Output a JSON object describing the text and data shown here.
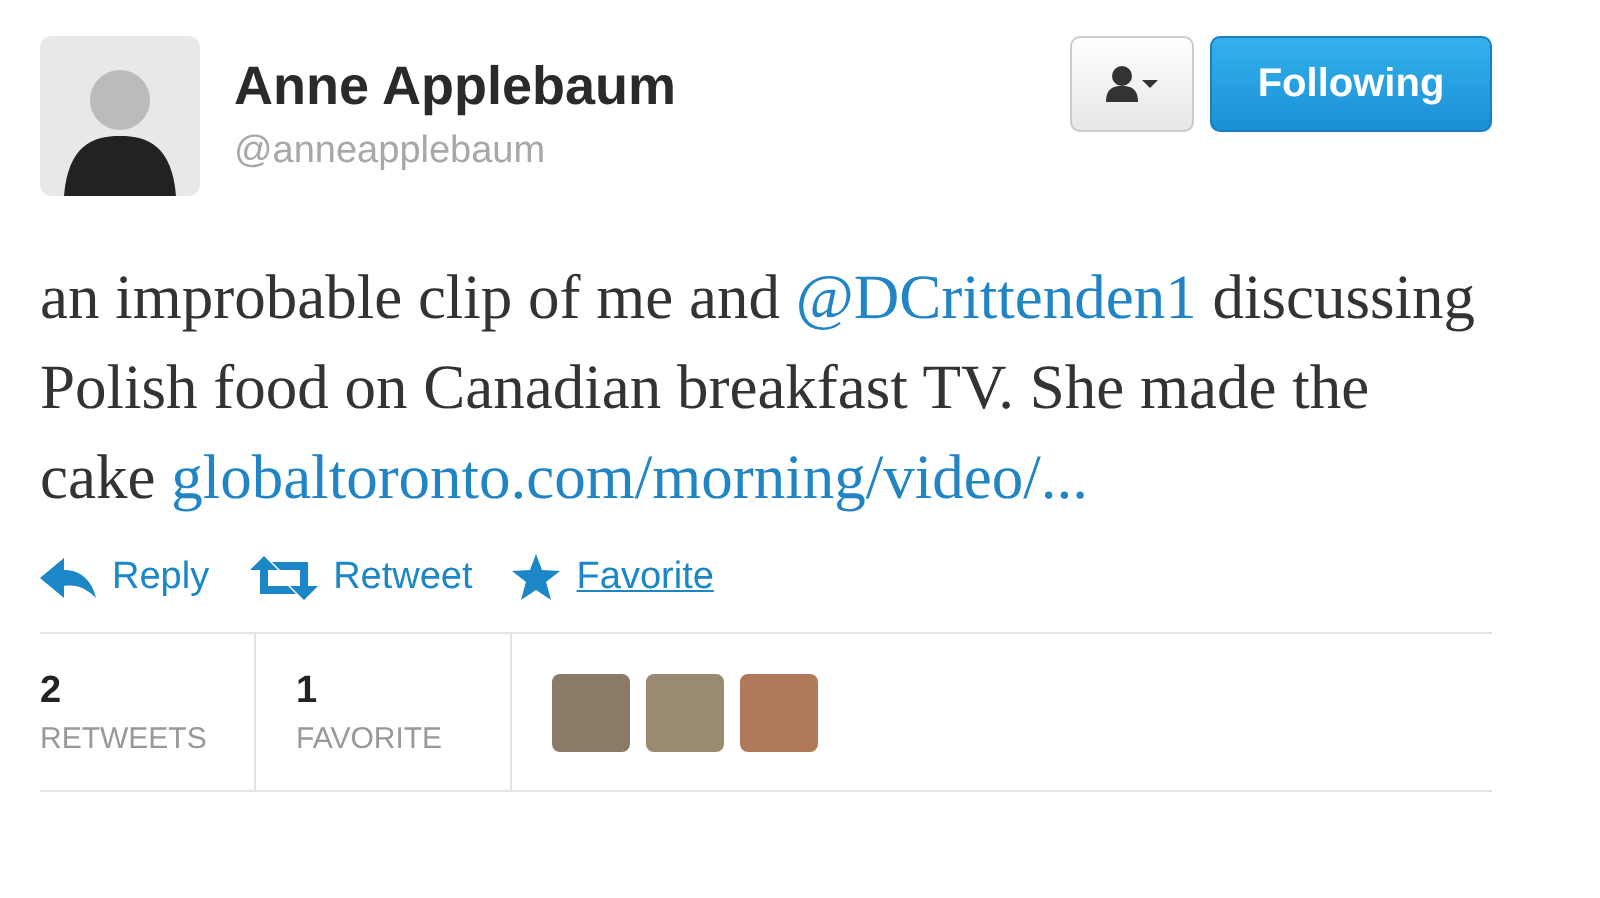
{
  "author": {
    "name": "Anne Applebaum",
    "handle": "@anneapplebaum"
  },
  "follow_button": {
    "label": "Following",
    "following": true
  },
  "tweet": [
    {
      "kind": "text",
      "text": "an improbable clip of me and "
    },
    {
      "kind": "link",
      "text": "@DCrittenden1"
    },
    {
      "kind": "text",
      "text": " discussing Polish food on Canadian breakfast TV. She made the cake "
    },
    {
      "kind": "link",
      "text": "globaltoronto.com/morning/video/..."
    }
  ],
  "actions": [
    {
      "label": "Reply",
      "kind": "reply",
      "hovered": false
    },
    {
      "label": "Retweet",
      "kind": "retweet",
      "hovered": false
    },
    {
      "label": "Favorite",
      "kind": "favorite",
      "hovered": true
    }
  ],
  "stats": [
    {
      "count": "2",
      "label": "RETWEETS"
    },
    {
      "count": "1",
      "label": "FAVORITE"
    }
  ],
  "favoriters": [
    {
      "color": "#8a7a66"
    },
    {
      "color": "#9a8a70"
    },
    {
      "color": "#b07a5a"
    }
  ]
}
